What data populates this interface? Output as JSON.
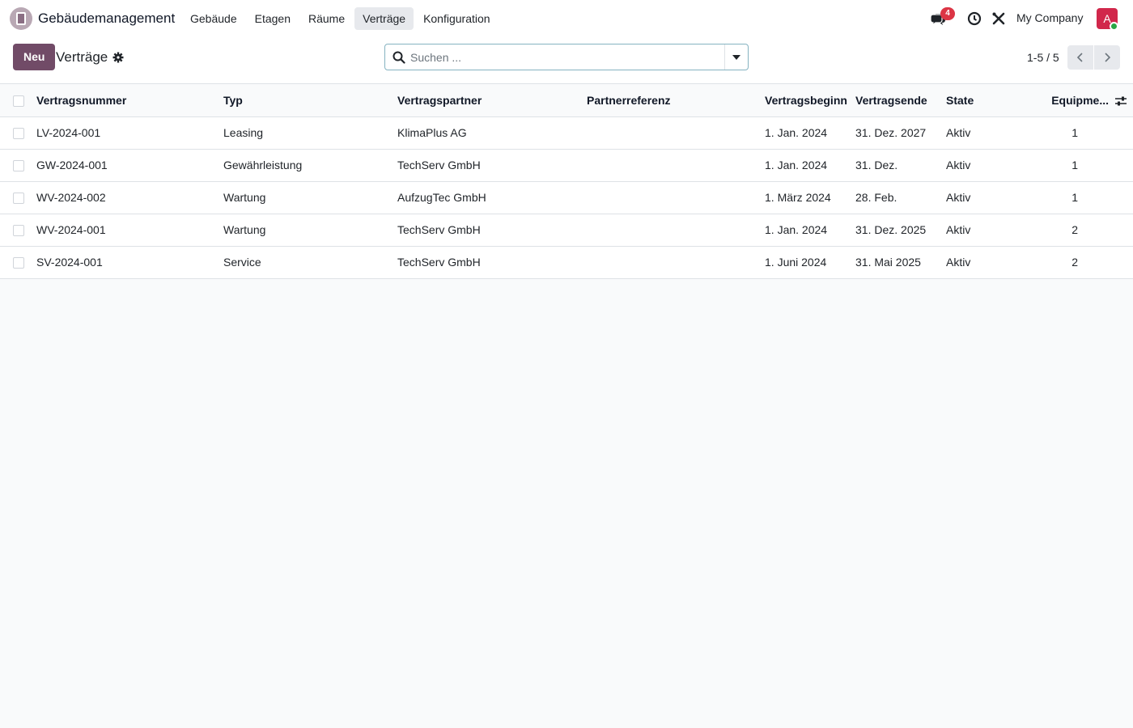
{
  "app": {
    "name": "Gebäudemanagement",
    "menu": [
      "Gebäude",
      "Etagen",
      "Räume",
      "Verträge",
      "Konfiguration"
    ],
    "active_menu": "Verträge"
  },
  "systray": {
    "messages_count": "4",
    "company": "My Company",
    "avatar_letter": "A"
  },
  "control": {
    "new_label": "Neu",
    "title": "Verträge",
    "search_placeholder": "Suchen ...",
    "search_value": "",
    "pager": "1-5 / 5"
  },
  "table": {
    "columns": [
      "Vertragsnummer",
      "Typ",
      "Vertragspartner",
      "Partnerreferenz",
      "Vertragsbeginn",
      "Vertragsende",
      "State",
      "Equipme..."
    ],
    "rows": [
      [
        "LV-2024-001",
        "Leasing",
        "KlimaPlus AG",
        "",
        "1. Jan. 2024",
        "31. Dez. 2027",
        "Aktiv",
        "1"
      ],
      [
        "GW-2024-001",
        "Gewährleistung",
        "TechServ GmbH",
        "",
        "1. Jan. 2024",
        "31. Dez.",
        "Aktiv",
        "1"
      ],
      [
        "WV-2024-002",
        "Wartung",
        "AufzugTec GmbH",
        "",
        "1. März 2024",
        "28. Feb.",
        "Aktiv",
        "1"
      ],
      [
        "WV-2024-001",
        "Wartung",
        "TechServ GmbH",
        "",
        "1. Jan. 2024",
        "31. Dez. 2025",
        "Aktiv",
        "2"
      ],
      [
        "SV-2024-001",
        "Service",
        "TechServ GmbH",
        "",
        "1. Juni 2024",
        "31. Mai 2025",
        "Aktiv",
        "2"
      ]
    ]
  },
  "colors": {
    "primary": "#714b67",
    "badge": "#dc3545",
    "avatar": "#d1274b",
    "presence": "#28a745"
  }
}
